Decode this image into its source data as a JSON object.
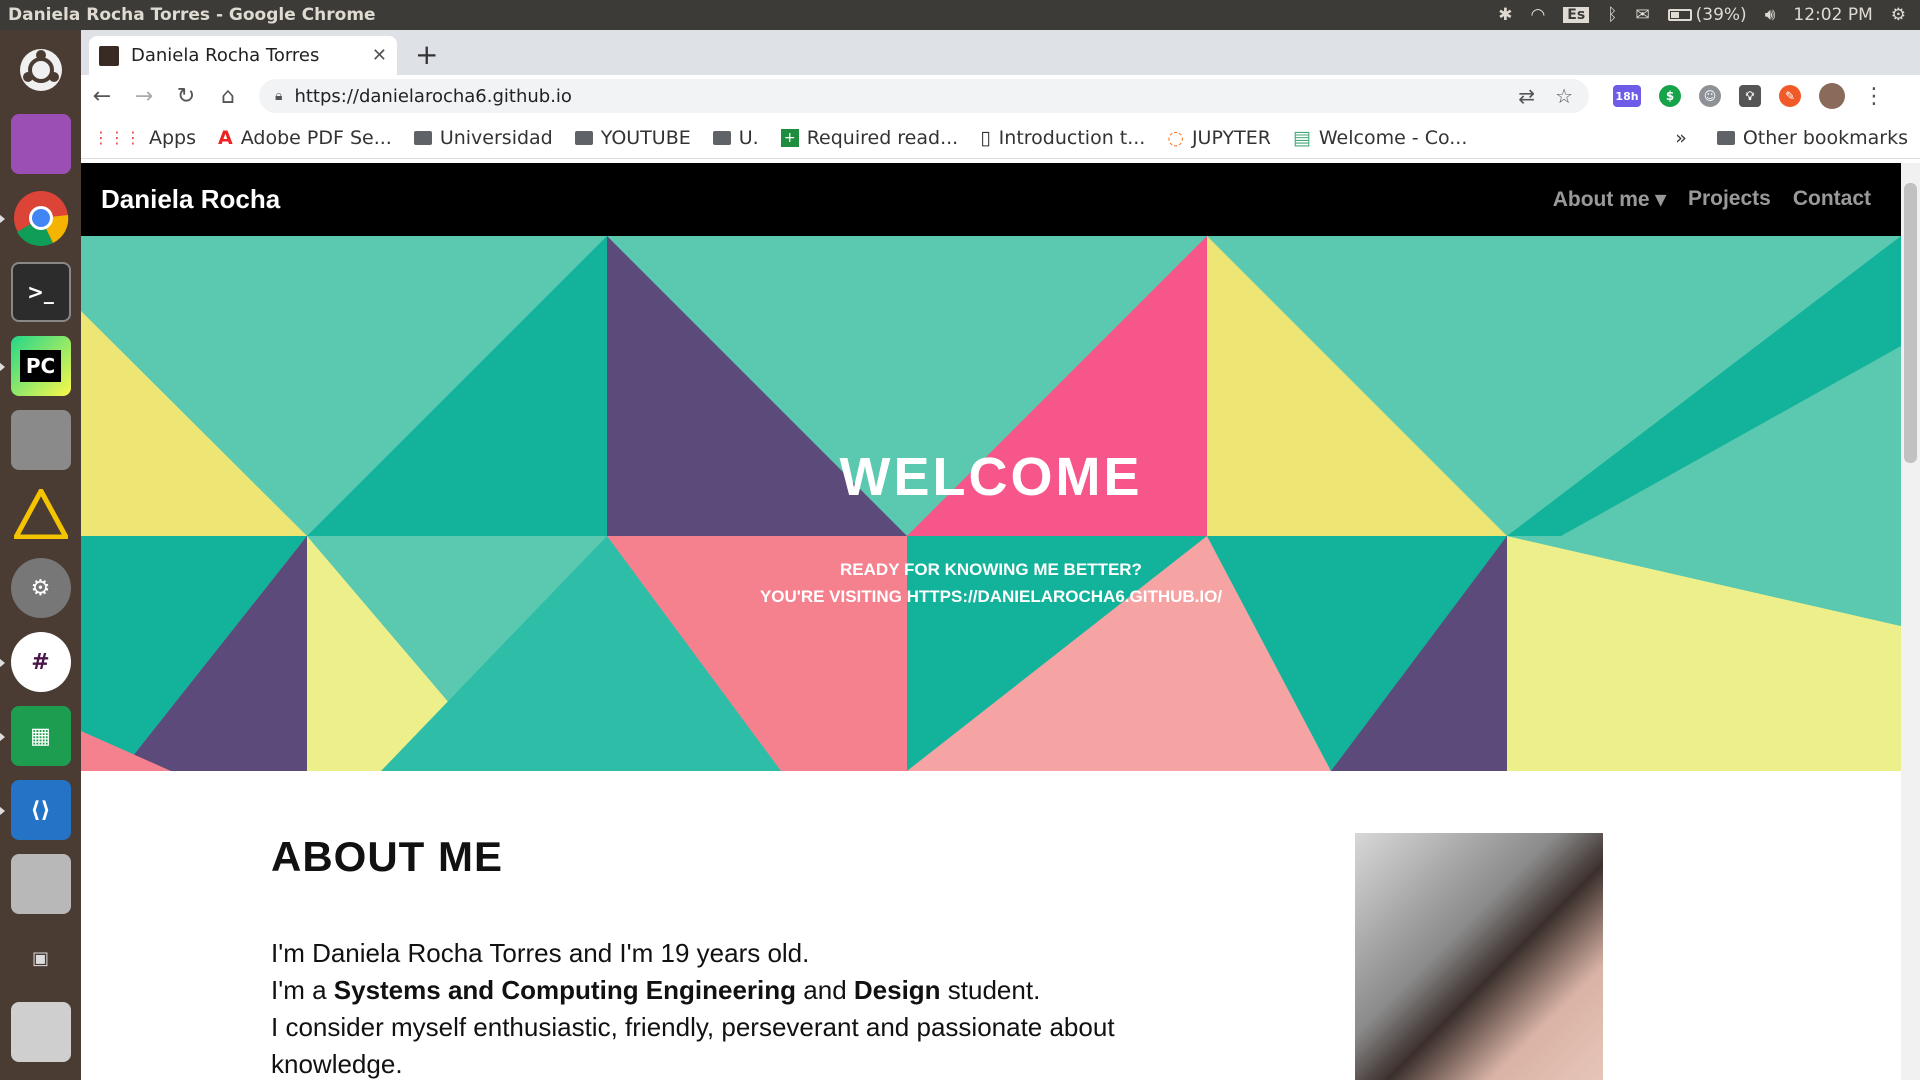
{
  "os": {
    "window_title": "Daniela Rocha Torres - Google Chrome",
    "language": "Es",
    "battery": "(39%)",
    "clock": "12:02 PM"
  },
  "browser": {
    "tab_title": "Daniela Rocha Torres",
    "url": "https://danielarocha6.github.io",
    "extension_badge": "18h",
    "bookmarks": [
      {
        "label": "Apps",
        "icon": "apps-grid-icon"
      },
      {
        "label": "Adobe PDF Se...",
        "icon": "adobe-icon"
      },
      {
        "label": "Universidad",
        "icon": "folder-icon"
      },
      {
        "label": "YOUTUBE",
        "icon": "folder-icon"
      },
      {
        "label": "U.",
        "icon": "folder-icon"
      },
      {
        "label": "Required read...",
        "icon": "doc-plus-icon"
      },
      {
        "label": "Introduction t...",
        "icon": "doc-icon"
      },
      {
        "label": "JUPYTER",
        "icon": "jupyter-icon"
      },
      {
        "label": "Welcome - Co...",
        "icon": "page-icon"
      }
    ],
    "overflow": "»",
    "other_bookmarks": "Other bookmarks"
  },
  "site": {
    "brand": "Daniela Rocha",
    "nav": [
      "About me",
      "Projects",
      "Contact"
    ],
    "hero": {
      "heading": "WELCOME",
      "line1": "READY FOR KNOWING ME BETTER?",
      "line2": "YOU'RE VISITING HTTPS://DANIELAROCHA6.GITHUB.IO/"
    },
    "about": {
      "heading": "ABOUT ME",
      "line1": "I'm Daniela Rocha Torres and I'm 19 years old.",
      "line2_pre": "I'm a ",
      "line2_bold1": "Systems and Computing Engineering",
      "line2_mid": " and ",
      "line2_bold2": "Design",
      "line2_post": " student.",
      "line3": "I consider myself enthusiastic, friendly, perseverant and passionate about knowledge."
    }
  },
  "colors": {
    "teal": "#5bc8b0",
    "dark_teal": "#13b39b",
    "purple": "#5b4a7a",
    "pink": "#f7568a",
    "yellow": "#ede675",
    "light_yellow": "#edf08a",
    "light_pink": "#f5818f"
  }
}
